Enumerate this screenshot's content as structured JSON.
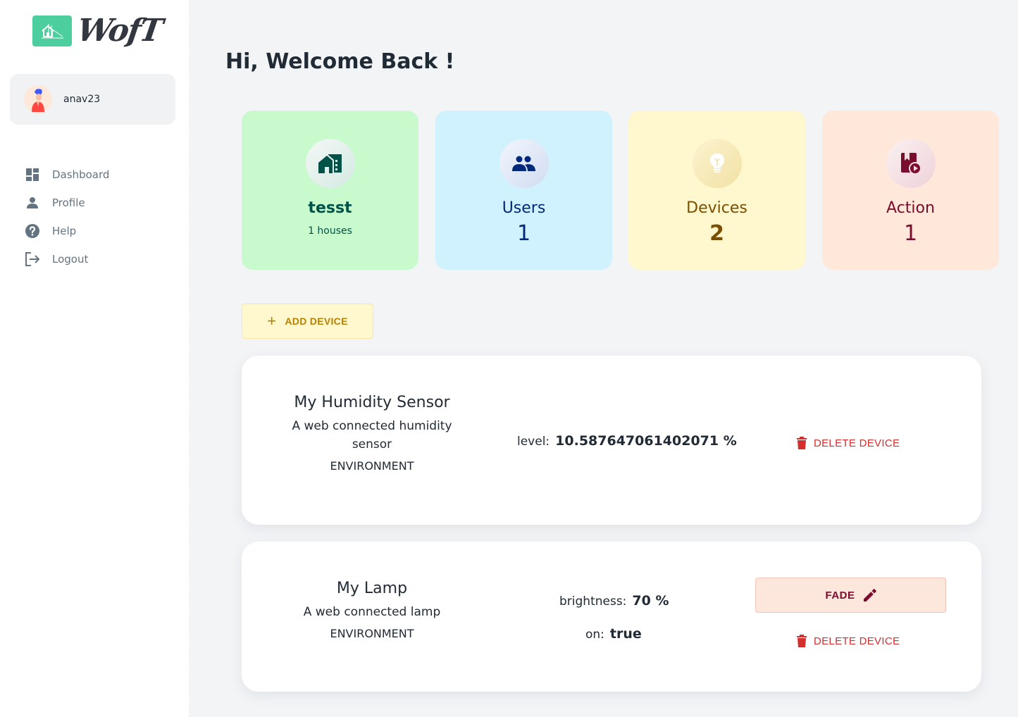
{
  "app": {
    "logo_text": "WofT"
  },
  "account": {
    "username": "anav23"
  },
  "nav": {
    "items": [
      {
        "label": "Dashboard",
        "icon": "dashboard-icon"
      },
      {
        "label": "Profile",
        "icon": "person-icon"
      },
      {
        "label": "Help",
        "icon": "help-circle-icon"
      },
      {
        "label": "Logout",
        "icon": "logout-icon"
      }
    ]
  },
  "main": {
    "title": "Hi, Welcome Back !",
    "stats": [
      {
        "title": "tesst",
        "subtitle": "1 houses",
        "icon": "house-icon",
        "bg": "#c8facd",
        "color": "#005249"
      },
      {
        "title": "Users",
        "value": "1",
        "icon": "users-icon",
        "bg": "#d0f2fe",
        "color": "#04297a"
      },
      {
        "title": "Devices",
        "value": "2",
        "icon": "lightbulb-icon",
        "bg": "#fff7cd",
        "color": "#7a4f01"
      },
      {
        "title": "Action",
        "value": "1",
        "icon": "action-play-icon",
        "bg": "#ffe7d9",
        "color": "#7a0c2e"
      }
    ],
    "add_device_label": "ADD DEVICE",
    "devices": [
      {
        "name": "My Humidity Sensor",
        "description": "A web connected humidity sensor",
        "category": "ENVIRONMENT",
        "properties": [
          {
            "label": "level:",
            "value": "10.587647061402071 %"
          }
        ],
        "actions": [],
        "delete_label": "DELETE DEVICE"
      },
      {
        "name": "My Lamp",
        "description": "A web connected lamp",
        "category": "ENVIRONMENT",
        "properties": [
          {
            "label": "brightness:",
            "value": "70 %"
          },
          {
            "label": "on:",
            "value": "true"
          }
        ],
        "actions": [
          {
            "label": "FADE",
            "icon": "pencil-icon"
          }
        ],
        "delete_label": "DELETE DEVICE"
      }
    ]
  },
  "colors": {
    "accent_green": "#4cce9f",
    "danger": "#d32f2f",
    "warning_text": "#b78103"
  }
}
